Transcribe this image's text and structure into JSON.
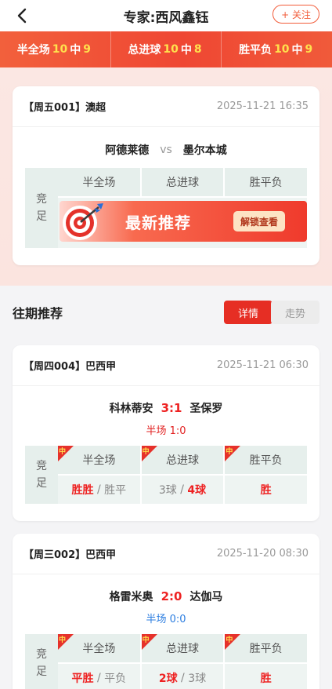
{
  "header": {
    "title": "专家:西风鑫钰",
    "follow_label": "+ 关注"
  },
  "stats": [
    {
      "label": "半全场",
      "total": "10",
      "mid": "中",
      "hit": "9"
    },
    {
      "label": "总进球",
      "total": "10",
      "mid": "中",
      "hit": "8"
    },
    {
      "label": "胜平负",
      "total": "10",
      "mid": "中",
      "hit": "9"
    }
  ],
  "current": {
    "league": "【周五001】澳超",
    "time": "2025-11-21 16:35",
    "home": "阿德莱德",
    "vs": "vs",
    "away": "墨尔本城",
    "side_1": "竞",
    "side_2": "足",
    "col_1": "半全场",
    "col_2": "总进球",
    "col_3": "胜平负",
    "promo_text": "最新推荐",
    "unlock_label": "解锁查看"
  },
  "past_section": {
    "title": "往期推荐",
    "tab_detail": "详情",
    "tab_trend": "走势"
  },
  "past_matches": [
    {
      "league": "【周四004】巴西甲",
      "time": "2025-11-21 06:30",
      "home": "科林蒂安",
      "score": "3:1",
      "away": "圣保罗",
      "half_label": "半场 1:0",
      "side_1": "竞",
      "side_2": "足",
      "flag": "中",
      "col_1": "半全场",
      "col_2": "总进球",
      "col_3": "胜平负",
      "c1_hit": "胜胜",
      "c1_sep": " / ",
      "c1_other": "胜平",
      "c2_other": "3球",
      "c2_sep": " / ",
      "c2_hit": "4球",
      "c3_hit": "胜"
    },
    {
      "league": "【周三002】巴西甲",
      "time": "2025-11-20 08:30",
      "home": "格雷米奥",
      "score": "2:0",
      "away": "达伽马",
      "half_label": "半场 0:0",
      "side_1": "竞",
      "side_2": "足",
      "flag": "中",
      "col_1": "半全场",
      "col_2": "总进球",
      "col_3": "胜平负",
      "c1_hit": "平胜",
      "c1_sep": " / ",
      "c1_other": "平负",
      "c2_hit": "2球",
      "c2_sep": " / ",
      "c2_other": "3球",
      "c3_hit": "胜"
    }
  ],
  "colors": {
    "accent": "#e62e24",
    "halftime_1": "#e22222",
    "halftime_2": "#2b7de0",
    "flag_text": "#ffe14d"
  }
}
